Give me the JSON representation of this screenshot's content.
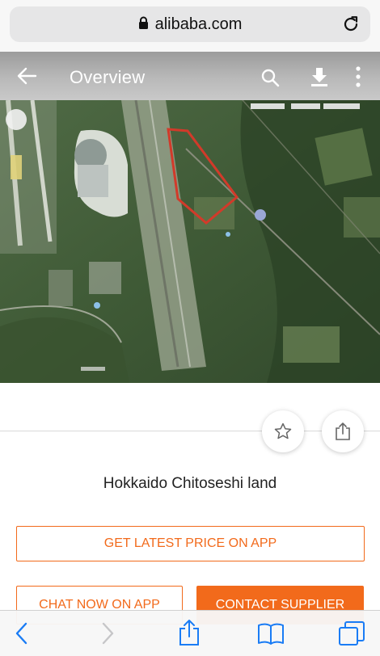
{
  "browser": {
    "url": "alibaba.com",
    "icons": {
      "lock": "lock-icon",
      "reload": "reload-icon"
    }
  },
  "app_bar": {
    "title": "Overview",
    "icons": [
      "back-arrow-icon",
      "search-icon",
      "download-icon",
      "more-vertical-icon"
    ]
  },
  "listing": {
    "image_alt": "satellite-map-image",
    "title": "Hokkaido Chitoseshi land",
    "actions": {
      "favorite_icon": "star-icon",
      "share_icon": "share-icon"
    }
  },
  "buttons": {
    "get_price": "GET LATEST PRICE ON APP",
    "chat_now": "CHAT NOW ON APP",
    "contact_supplier": "CONTACT SUPPLIER"
  },
  "toolbar": {
    "icons": [
      "back-chevron-icon",
      "forward-chevron-icon",
      "share-icon",
      "bookmarks-icon",
      "tabs-icon"
    ]
  },
  "colors": {
    "accent": "#f26a1b",
    "app_bar": "#b3b3b3",
    "ios_blue": "#1a7cf5"
  }
}
